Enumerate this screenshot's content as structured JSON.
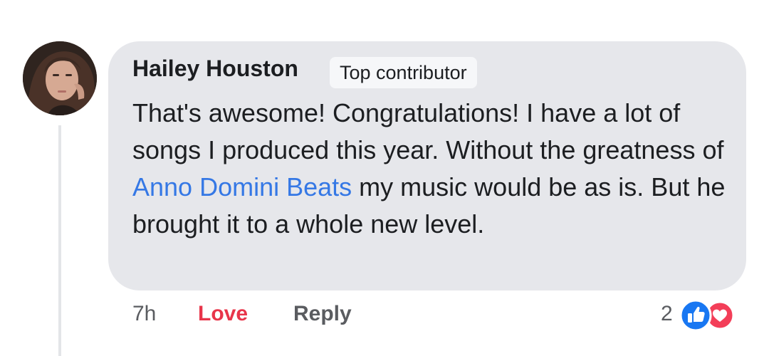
{
  "comment": {
    "author": "Hailey Houston",
    "badge": "Top contributor",
    "text_before_mention": "That's awesome! Congratulations! I have a lot of songs I produced this year. Without the greatness of ",
    "mention": "Anno Domini Beats",
    "text_after_mention": " my music would be as is. But he brought it to a whole new level.",
    "time": "7h",
    "reacted_action": "Love",
    "reply_label": "Reply",
    "reaction_count": "2",
    "reaction_icons": [
      "like-icon",
      "love-icon"
    ]
  },
  "colors": {
    "bubble": "#e6e7eb",
    "mention_link": "#3578e5",
    "love_action": "#e8354a",
    "like_icon": "#1877f2",
    "love_icon": "#f33e58"
  }
}
